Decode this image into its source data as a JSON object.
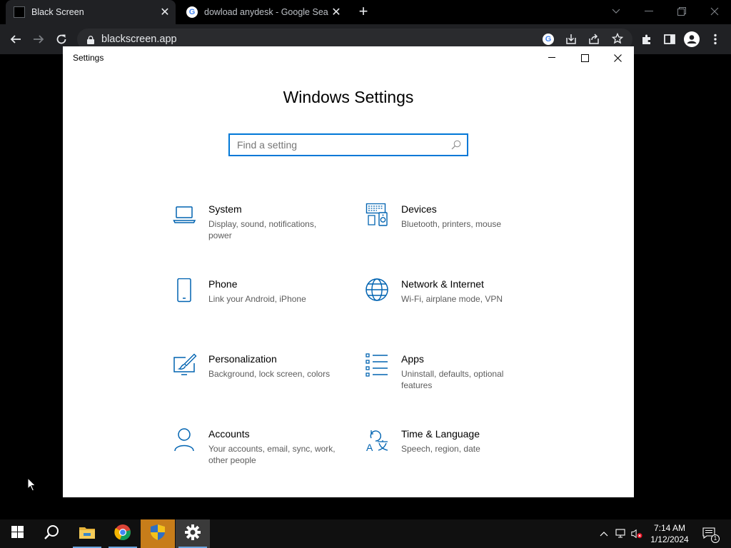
{
  "browser": {
    "tabs": [
      {
        "title": "Black Screen",
        "active": true
      },
      {
        "title": "dowload anydesk - Google Search",
        "active": false
      }
    ],
    "url": "blackscreen.app"
  },
  "settings": {
    "window_title": "Settings",
    "heading": "Windows Settings",
    "search_placeholder": "Find a setting",
    "categories": [
      {
        "label": "System",
        "desc": "Display, sound, notifications, power",
        "icon": "laptop-icon"
      },
      {
        "label": "Devices",
        "desc": "Bluetooth, printers, mouse",
        "icon": "devices-icon"
      },
      {
        "label": "Phone",
        "desc": "Link your Android, iPhone",
        "icon": "phone-icon"
      },
      {
        "label": "Network & Internet",
        "desc": "Wi-Fi, airplane mode, VPN",
        "icon": "globe-icon"
      },
      {
        "label": "Personalization",
        "desc": "Background, lock screen, colors",
        "icon": "paint-icon"
      },
      {
        "label": "Apps",
        "desc": "Uninstall, defaults, optional features",
        "icon": "apps-list-icon"
      },
      {
        "label": "Accounts",
        "desc": "Your accounts, email, sync, work, other people",
        "icon": "person-icon"
      },
      {
        "label": "Time & Language",
        "desc": "Speech, region, date",
        "icon": "time-language-icon"
      }
    ]
  },
  "taskbar": {
    "time": "7:14 AM",
    "date": "1/12/2024",
    "notification_count": "1"
  },
  "colors": {
    "accent": "#0078d7",
    "browser_dark": "#202124",
    "taskbar": "#101010"
  }
}
